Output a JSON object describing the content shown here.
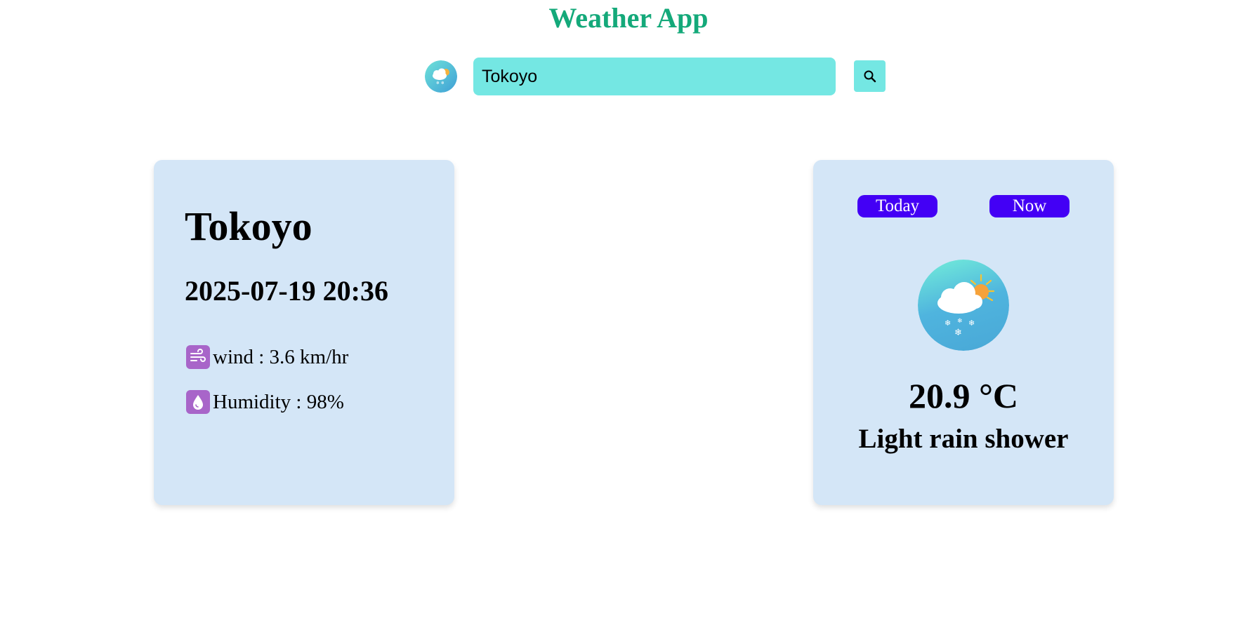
{
  "header": {
    "title": "Weather App"
  },
  "search": {
    "value": "Tokoyo",
    "icon": "search-icon"
  },
  "logo": {
    "icon": "snow-cloud-sun-icon"
  },
  "details_card": {
    "city": "Tokoyo",
    "datetime": "2025-07-19 20:36",
    "wind_label": "wind : 3.6 km/hr",
    "wind_icon": "wind-icon",
    "humidity_label": "Humidity : 98%",
    "humidity_icon": "water-drop-icon"
  },
  "current_card": {
    "tabs": [
      "Today",
      "Now"
    ],
    "icon": "snow-cloud-sun-icon",
    "temperature": "20.9 °C",
    "condition": "Light rain shower"
  },
  "colors": {
    "title": "#14a97a",
    "search_bg": "#74e7e3",
    "card_bg": "#d4e6f7",
    "pill_bg": "#4300f5",
    "stat_icon_bg": "#a865c9"
  }
}
